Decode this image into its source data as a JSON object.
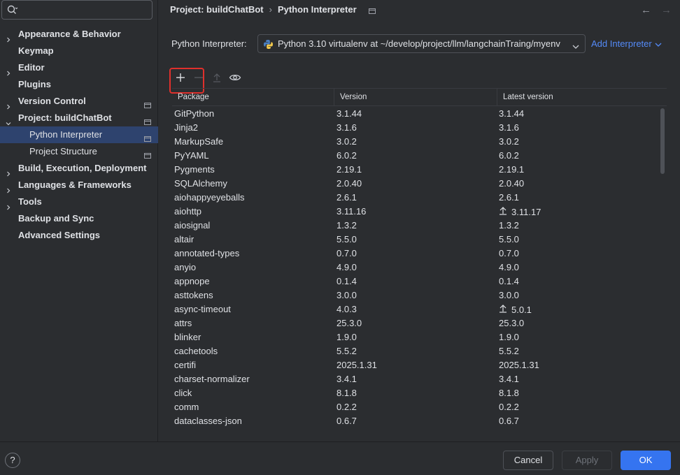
{
  "colors": {
    "accent": "#3574f0",
    "selection": "#2e436e",
    "link": "#548af7",
    "highlight": "#e0302c"
  },
  "search": {
    "placeholder": "",
    "value": ""
  },
  "sidebar": {
    "items": [
      {
        "label": "Appearance & Behavior",
        "chevron": true,
        "project": false
      },
      {
        "label": "Keymap",
        "chevron": false,
        "project": false
      },
      {
        "label": "Editor",
        "chevron": true,
        "project": false
      },
      {
        "label": "Plugins",
        "chevron": false,
        "project": false
      },
      {
        "label": "Version Control",
        "chevron": true,
        "project": true
      },
      {
        "label": "Project: buildChatBot",
        "chevron": "down",
        "project": true
      },
      {
        "label": "Python Interpreter",
        "child": true,
        "selected": true,
        "project": true
      },
      {
        "label": "Project Structure",
        "child": true,
        "project": true
      },
      {
        "label": "Build, Execution, Deployment",
        "chevron": true,
        "project": false
      },
      {
        "label": "Languages & Frameworks",
        "chevron": true,
        "project": false
      },
      {
        "label": "Tools",
        "chevron": true,
        "project": false
      },
      {
        "label": "Backup and Sync",
        "chevron": false,
        "project": false
      },
      {
        "label": "Advanced Settings",
        "chevron": false,
        "project": false
      }
    ]
  },
  "breadcrumb": {
    "parent": "Project: buildChatBot",
    "current": "Python Interpreter"
  },
  "interpreter": {
    "label": "Python Interpreter:",
    "value": "Python 3.10 virtualenv at ~/develop/project/llm/langchainTraing/myenv",
    "add_label": "Add Interpreter"
  },
  "toolbar": {
    "icons": [
      "add-icon",
      "remove-icon",
      "upgrade-icon",
      "eye-icon"
    ]
  },
  "table": {
    "headers": [
      "Package",
      "Version",
      "Latest version"
    ],
    "rows": [
      {
        "package": "GitPython",
        "version": "3.1.44",
        "latest": "3.1.44",
        "upgrade": false
      },
      {
        "package": "Jinja2",
        "version": "3.1.6",
        "latest": "3.1.6",
        "upgrade": false
      },
      {
        "package": "MarkupSafe",
        "version": "3.0.2",
        "latest": "3.0.2",
        "upgrade": false
      },
      {
        "package": "PyYAML",
        "version": "6.0.2",
        "latest": "6.0.2",
        "upgrade": false
      },
      {
        "package": "Pygments",
        "version": "2.19.1",
        "latest": "2.19.1",
        "upgrade": false
      },
      {
        "package": "SQLAlchemy",
        "version": "2.0.40",
        "latest": "2.0.40",
        "upgrade": false
      },
      {
        "package": "aiohappyeyeballs",
        "version": "2.6.1",
        "latest": "2.6.1",
        "upgrade": false
      },
      {
        "package": "aiohttp",
        "version": "3.11.16",
        "latest": "3.11.17",
        "upgrade": true
      },
      {
        "package": "aiosignal",
        "version": "1.3.2",
        "latest": "1.3.2",
        "upgrade": false
      },
      {
        "package": "altair",
        "version": "5.5.0",
        "latest": "5.5.0",
        "upgrade": false
      },
      {
        "package": "annotated-types",
        "version": "0.7.0",
        "latest": "0.7.0",
        "upgrade": false
      },
      {
        "package": "anyio",
        "version": "4.9.0",
        "latest": "4.9.0",
        "upgrade": false
      },
      {
        "package": "appnope",
        "version": "0.1.4",
        "latest": "0.1.4",
        "upgrade": false
      },
      {
        "package": "asttokens",
        "version": "3.0.0",
        "latest": "3.0.0",
        "upgrade": false
      },
      {
        "package": "async-timeout",
        "version": "4.0.3",
        "latest": "5.0.1",
        "upgrade": true
      },
      {
        "package": "attrs",
        "version": "25.3.0",
        "latest": "25.3.0",
        "upgrade": false
      },
      {
        "package": "blinker",
        "version": "1.9.0",
        "latest": "1.9.0",
        "upgrade": false
      },
      {
        "package": "cachetools",
        "version": "5.5.2",
        "latest": "5.5.2",
        "upgrade": false
      },
      {
        "package": "certifi",
        "version": "2025.1.31",
        "latest": "2025.1.31",
        "upgrade": false
      },
      {
        "package": "charset-normalizer",
        "version": "3.4.1",
        "latest": "3.4.1",
        "upgrade": false
      },
      {
        "package": "click",
        "version": "8.1.8",
        "latest": "8.1.8",
        "upgrade": false
      },
      {
        "package": "comm",
        "version": "0.2.2",
        "latest": "0.2.2",
        "upgrade": false
      },
      {
        "package": "dataclasses-json",
        "version": "0.6.7",
        "latest": "0.6.7",
        "upgrade": false
      }
    ]
  },
  "footer": {
    "help": "?",
    "cancel": "Cancel",
    "apply": "Apply",
    "ok": "OK"
  }
}
